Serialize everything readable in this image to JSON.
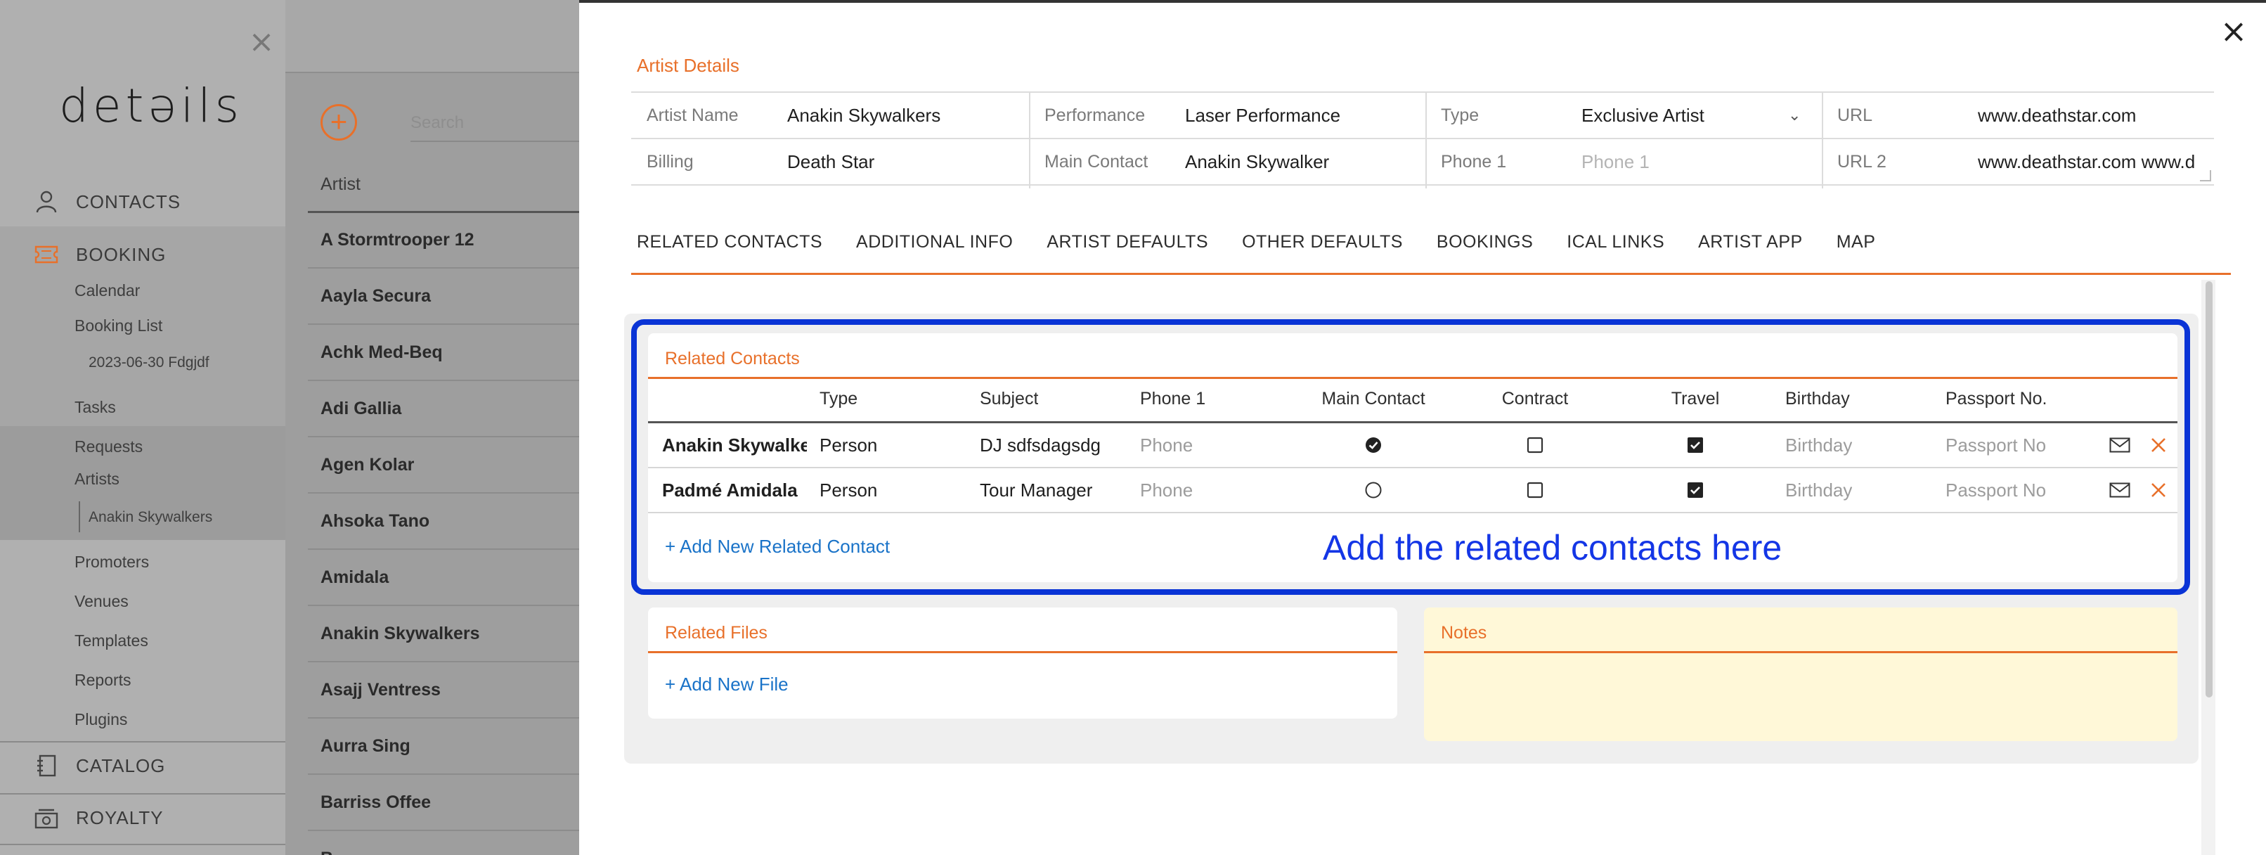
{
  "sidebar": {
    "logo": "detəils",
    "nav": {
      "contacts": "CONTACTS",
      "booking": "BOOKING",
      "catalog": "CATALOG",
      "royalty": "ROYALTY"
    },
    "booking_items": {
      "calendar": "Calendar",
      "booking_list": "Booking List",
      "booking_entry": "2023-06-30 Fdgjdf",
      "tasks": "Tasks",
      "requests": "Requests",
      "artists": "Artists",
      "artist_child": "Anakin Skywalkers",
      "promoters": "Promoters",
      "venues": "Venues",
      "templates": "Templates",
      "reports": "Reports",
      "plugins": "Plugins"
    }
  },
  "artist_list": {
    "search_placeholder": "Search",
    "header": "Artist",
    "rows": [
      "A Stormtrooper 12",
      "Aayla Secura",
      "Achk Med-Beq",
      "Adi Gallia",
      "Agen Kolar",
      "Ahsoka Tano",
      "Amidala",
      "Anakin Skywalkers",
      "Asajj Ventress",
      "Aurra Sing",
      "Barriss Offee",
      "B..."
    ]
  },
  "details": {
    "title": "Artist Details",
    "fields": {
      "artist_name_label": "Artist Name",
      "artist_name": "Anakin Skywalkers",
      "performance_label": "Performance",
      "performance": "Laser Performance",
      "type_label": "Type",
      "type": "Exclusive Artist",
      "url_label": "URL",
      "url": "www.deathstar.com",
      "billing_label": "Billing",
      "billing": "Death Star",
      "main_contact_label": "Main Contact",
      "main_contact": "Anakin Skywalker",
      "phone1_label": "Phone 1",
      "phone1_placeholder": "Phone 1",
      "url2_label": "URL 2",
      "url2": "www.deathstar.com www.d"
    }
  },
  "tabs": [
    "RELATED CONTACTS",
    "ADDITIONAL INFO",
    "ARTIST DEFAULTS",
    "OTHER DEFAULTS",
    "BOOKINGS",
    "ICAL LINKS",
    "ARTIST APP",
    "MAP"
  ],
  "related_contacts": {
    "title": "Related Contacts",
    "columns": {
      "type": "Type",
      "subject": "Subject",
      "phone1": "Phone 1",
      "main_contact": "Main Contact",
      "contract": "Contract",
      "travel": "Travel",
      "birthday": "Birthday",
      "passport": "Passport No."
    },
    "rows": [
      {
        "name": "Anakin Skywalker",
        "type": "Person",
        "subject": "DJ sdfsdagsdg",
        "phone": "Phone",
        "birthday": "Birthday",
        "passport": "Passport No",
        "main_contact": true,
        "contract": false,
        "travel": true
      },
      {
        "name": "Padmé Amidala",
        "type": "Person",
        "subject": "Tour Manager",
        "phone": "Phone",
        "birthday": "Birthday",
        "passport": "Passport No",
        "main_contact": false,
        "contract": false,
        "travel": true
      }
    ],
    "add_link": "+ Add New Related Contact",
    "annotation": "Add the related contacts here"
  },
  "related_files": {
    "title": "Related Files",
    "add_link": "+ Add New File"
  },
  "notes": {
    "title": "Notes"
  },
  "colors": {
    "accent": "#e8702a",
    "link": "#1a73c8",
    "highlight": "#0a34d6"
  }
}
